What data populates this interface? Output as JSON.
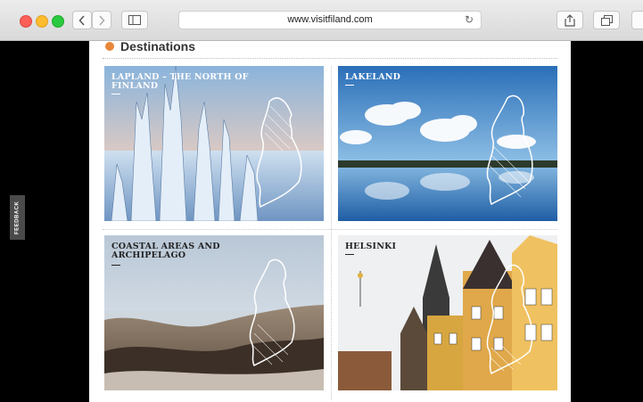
{
  "browser": {
    "url": "www.visitfiland.com",
    "icons": [
      "back-chevron-icon",
      "forward-chevron-icon",
      "sidebar-icon",
      "reload-icon",
      "share-icon",
      "tabs-icon"
    ]
  },
  "page": {
    "section_title": "Destinations",
    "feedback_label": "FEEDBACK",
    "cards": [
      {
        "title": "LAPLAND – THE NORTH OF FINLAND"
      },
      {
        "title": "LAKELAND"
      },
      {
        "title": "COASTAL AREAS AND ARCHIPELAGO"
      },
      {
        "title": "HELSINKI"
      }
    ]
  },
  "colors": {
    "accent_dot": "#e8873a"
  }
}
